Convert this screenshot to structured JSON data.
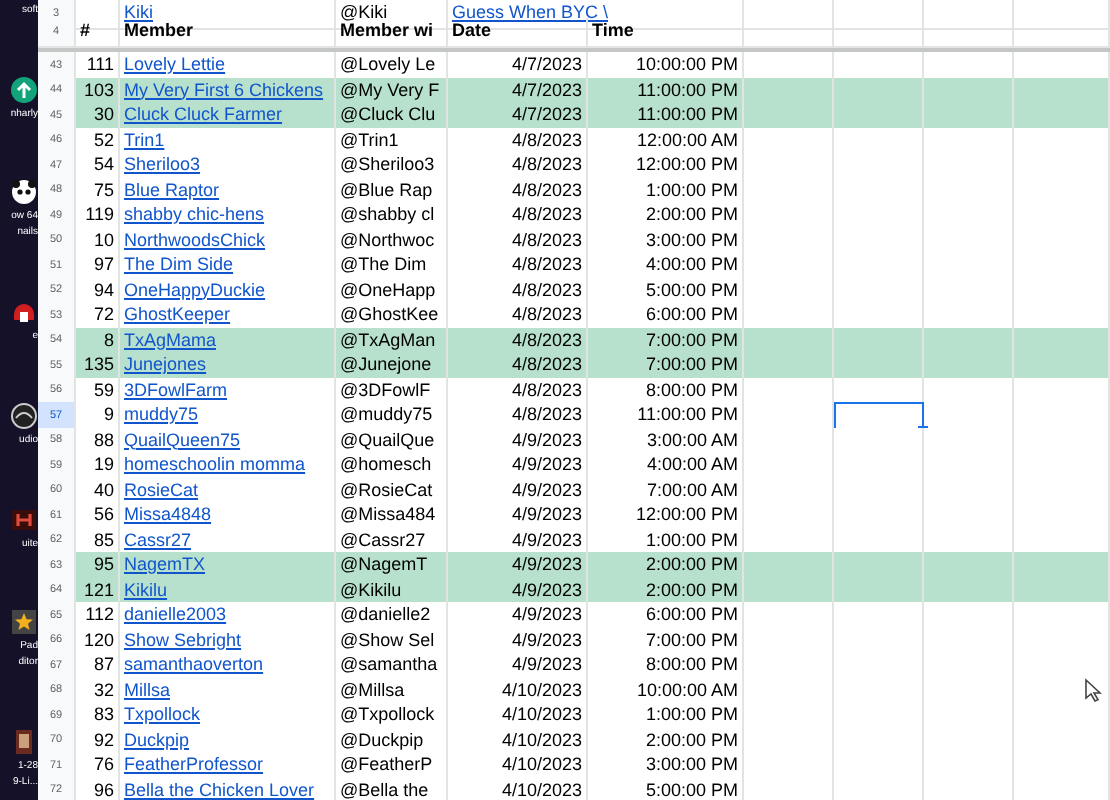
{
  "desktop_icons": [
    {
      "kind": "none",
      "lines": [
        "soft"
      ]
    },
    {
      "kind": "green",
      "lines": [
        "nharly"
      ]
    },
    {
      "kind": "panda",
      "lines": [
        "ow 64",
        "nails"
      ]
    },
    {
      "kind": "red",
      "lines": [
        "e"
      ]
    },
    {
      "kind": "audio",
      "lines": [
        "udio"
      ]
    },
    {
      "kind": "suite",
      "lines": [
        "uite"
      ]
    },
    {
      "kind": "star",
      "lines": [
        "Pad",
        "ditor"
      ]
    },
    {
      "kind": "file",
      "lines": [
        "1-28",
        "9-Li..."
      ]
    }
  ],
  "top_row": {
    "row": "3",
    "member": "Kiki",
    "handle": "@Kiki",
    "link": "Guess When BYC \\"
  },
  "header_row": "4",
  "columns": [
    "#",
    "Member",
    "Member wi",
    "Date",
    "Time"
  ],
  "rows": [
    {
      "row": "43",
      "num": "111",
      "member": "Lovely Lettie",
      "handle": "@Lovely Le",
      "date": "4/7/2023",
      "time": "10:00:00 PM",
      "highlighted": false,
      "selected": false
    },
    {
      "row": "44",
      "num": "103",
      "member": "My Very First 6 Chickens",
      "handle": "@My Very F",
      "date": "4/7/2023",
      "time": "11:00:00 PM",
      "highlighted": true,
      "selected": false
    },
    {
      "row": "45",
      "num": "30",
      "member": "Cluck Cluck Farmer",
      "handle": "@Cluck Clu",
      "date": "4/7/2023",
      "time": "11:00:00 PM",
      "highlighted": true,
      "selected": false
    },
    {
      "row": "46",
      "num": "52",
      "member": "Trin1",
      "handle": "@Trin1",
      "date": "4/8/2023",
      "time": "12:00:00 AM",
      "highlighted": false,
      "selected": false
    },
    {
      "row": "47",
      "num": "54",
      "member": "Sheriloo3",
      "handle": "@Sheriloo3",
      "date": "4/8/2023",
      "time": "12:00:00 PM",
      "highlighted": false,
      "selected": false
    },
    {
      "row": "48",
      "num": "75",
      "member": "Blue Raptor",
      "handle": "@Blue Rap",
      "date": "4/8/2023",
      "time": "1:00:00 PM",
      "highlighted": false,
      "selected": false
    },
    {
      "row": "49",
      "num": "119",
      "member": "shabby chic-hens",
      "handle": "@shabby cl",
      "date": "4/8/2023",
      "time": "2:00:00 PM",
      "highlighted": false,
      "selected": false
    },
    {
      "row": "50",
      "num": "10",
      "member": "NorthwoodsChick",
      "handle": "@Northwoc",
      "date": "4/8/2023",
      "time": "3:00:00 PM",
      "highlighted": false,
      "selected": false
    },
    {
      "row": "51",
      "num": "97",
      "member": "The Dim Side",
      "handle": "@The Dim",
      "date": "4/8/2023",
      "time": "4:00:00 PM",
      "highlighted": false,
      "selected": false
    },
    {
      "row": "52",
      "num": "94",
      "member": "OneHappyDuckie",
      "handle": "@OneHapp",
      "date": "4/8/2023",
      "time": "5:00:00 PM",
      "highlighted": false,
      "selected": false
    },
    {
      "row": "53",
      "num": "72",
      "member": "GhostKeeper",
      "handle": "@GhostKee",
      "date": "4/8/2023",
      "time": "6:00:00 PM",
      "highlighted": false,
      "selected": false
    },
    {
      "row": "54",
      "num": "8",
      "member": "TxAgMama",
      "handle": "@TxAgMan",
      "date": "4/8/2023",
      "time": "7:00:00 PM",
      "highlighted": true,
      "selected": false
    },
    {
      "row": "55",
      "num": "135",
      "member": "Junejones",
      "handle": "@Junejone",
      "date": "4/8/2023",
      "time": "7:00:00 PM",
      "highlighted": true,
      "selected": false
    },
    {
      "row": "56",
      "num": "59",
      "member": "3DFowlFarm",
      "handle": "@3DFowlF",
      "date": "4/8/2023",
      "time": "8:00:00 PM",
      "highlighted": false,
      "selected": false
    },
    {
      "row": "57",
      "num": "9",
      "member": "muddy75",
      "handle": "@muddy75",
      "date": "4/8/2023",
      "time": "11:00:00 PM",
      "highlighted": false,
      "selected": true
    },
    {
      "row": "58",
      "num": "88",
      "member": "QuailQueen75",
      "handle": "@QuailQue",
      "date": "4/9/2023",
      "time": "3:00:00 AM",
      "highlighted": false,
      "selected": false
    },
    {
      "row": "59",
      "num": "19",
      "member": "homeschoolin momma",
      "handle": "@homesch",
      "date": "4/9/2023",
      "time": "4:00:00 AM",
      "highlighted": false,
      "selected": false
    },
    {
      "row": "60",
      "num": "40",
      "member": "RosieCat",
      "handle": "@RosieCat",
      "date": "4/9/2023",
      "time": "7:00:00 AM",
      "highlighted": false,
      "selected": false
    },
    {
      "row": "61",
      "num": "56",
      "member": "Missa4848",
      "handle": "@Missa484",
      "date": "4/9/2023",
      "time": "12:00:00 PM",
      "highlighted": false,
      "selected": false
    },
    {
      "row": "62",
      "num": "85",
      "member": "Cassr27",
      "handle": "@Cassr27",
      "date": "4/9/2023",
      "time": "1:00:00 PM",
      "highlighted": false,
      "selected": false
    },
    {
      "row": "63",
      "num": "95",
      "member": "NagemTX",
      "handle": "@NagemT",
      "date": "4/9/2023",
      "time": "2:00:00 PM",
      "highlighted": true,
      "selected": false
    },
    {
      "row": "64",
      "num": "121",
      "member": "Kikilu",
      "handle": "@Kikilu",
      "date": "4/9/2023",
      "time": "2:00:00 PM",
      "highlighted": true,
      "selected": false
    },
    {
      "row": "65",
      "num": "112",
      "member": "danielle2003",
      "handle": "@danielle2",
      "date": "4/9/2023",
      "time": "6:00:00 PM",
      "highlighted": false,
      "selected": false
    },
    {
      "row": "66",
      "num": "120",
      "member": "Show Sebright",
      "handle": "@Show Sel",
      "date": "4/9/2023",
      "time": "7:00:00 PM",
      "highlighted": false,
      "selected": false
    },
    {
      "row": "67",
      "num": "87",
      "member": "samanthaoverton",
      "handle": "@samantha",
      "date": "4/9/2023",
      "time": "8:00:00 PM",
      "highlighted": false,
      "selected": false
    },
    {
      "row": "68",
      "num": "32",
      "member": "Millsa",
      "handle": "@Millsa",
      "date": "4/10/2023",
      "time": "10:00:00 AM",
      "highlighted": false,
      "selected": false
    },
    {
      "row": "69",
      "num": "83",
      "member": "Txpollock",
      "handle": "@Txpollock",
      "date": "4/10/2023",
      "time": "1:00:00 PM",
      "highlighted": false,
      "selected": false
    },
    {
      "row": "70",
      "num": "92",
      "member": "Duckpip",
      "handle": "@Duckpip",
      "date": "4/10/2023",
      "time": "2:00:00 PM",
      "highlighted": false,
      "selected": false
    },
    {
      "row": "71",
      "num": "76",
      "member": "FeatherProfessor",
      "handle": "@FeatherP",
      "date": "4/10/2023",
      "time": "3:00:00 PM",
      "highlighted": false,
      "selected": false
    },
    {
      "row": "72",
      "num": "96",
      "member": "Bella the Chicken Lover",
      "handle": "@Bella the",
      "date": "4/10/2023",
      "time": "5:00:00 PM",
      "highlighted": false,
      "selected": false
    }
  ]
}
